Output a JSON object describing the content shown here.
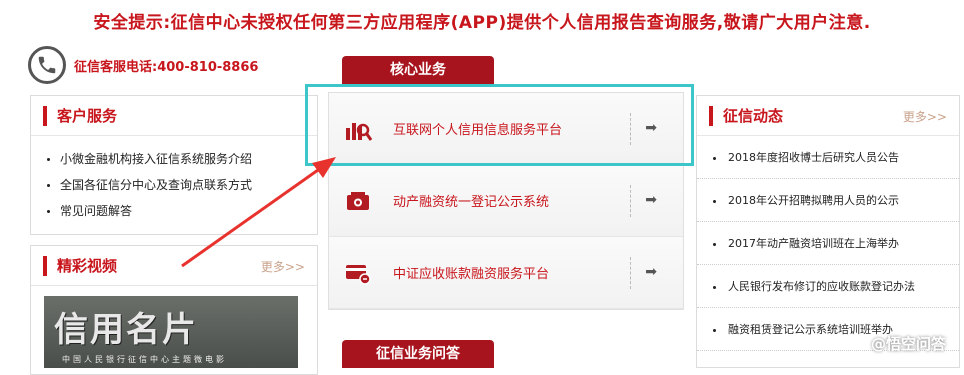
{
  "notice": "安全提示:征信中心未授权任何第三方应用程序(APP)提供个人信用报告查询服务,敬请广大用户注意.",
  "hotline": "征信客服电话:400-810-8866",
  "left_panel": {
    "title": "客户服务",
    "items": [
      "小微金融机构接入征信系统服务介绍",
      "全国各征信分中心及查询点联系方式",
      "常见问题解答"
    ]
  },
  "video_panel": {
    "title": "精彩视频",
    "more": "更多>>",
    "video_title": "信用名片",
    "video_sub": "中国人民银行征信中心主题微电影"
  },
  "center": {
    "tab_core": "核心业务",
    "services": [
      {
        "label": "互联网个人信用信息服务平台",
        "icon": "chart-magnifier-icon"
      },
      {
        "label": "动产融资统一登记公示系统",
        "icon": "registry-icon"
      },
      {
        "label": "中证应收账款融资服务平台",
        "icon": "receivable-card-icon"
      }
    ],
    "tab_qa": "征信业务问答"
  },
  "right_panel": {
    "title": "征信动态",
    "more": "更多>>",
    "items": [
      "2018年度招收博士后研究人员公告",
      "2018年公开招聘拟聘用人员的公示",
      "2017年动产融资培训班在上海举办",
      "人民银行发布修订的应收账款登记办法",
      "融资租赁登记公示系统培训班举办"
    ]
  },
  "watermark": "@悟空问答",
  "colors": {
    "brand_red": "#c8161d",
    "tab_red": "#a8141e",
    "highlight_cyan": "#3cc6c9",
    "annotation_arrow": "#e8322d"
  }
}
